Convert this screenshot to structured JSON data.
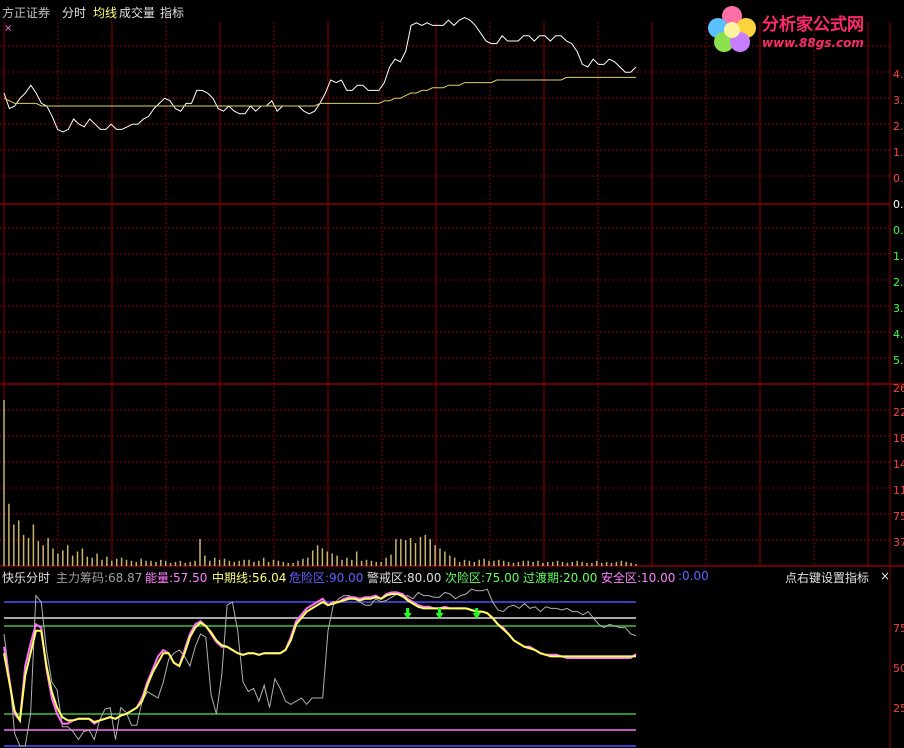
{
  "header": {
    "broker": "方正证券",
    "tabs": [
      "分时",
      "均线",
      "成交量",
      "指标"
    ],
    "tab_colors": [
      "#e0e0e0",
      "#ffff80",
      "#e0e0e0",
      "#e0e0e0"
    ]
  },
  "watermark": {
    "name": "分析家公式网",
    "url": "www.88gs.com"
  },
  "price_axis_labels": [
    "4.",
    "3.",
    "2.",
    "1.",
    "0.",
    "0.",
    "0.",
    "1.",
    "2.",
    "3.",
    "4.",
    "5."
  ],
  "volume_axis_labels": [
    "26",
    "22",
    "18",
    "14",
    "11",
    "75",
    "37"
  ],
  "indicator_axis_labels": [
    "75",
    "50",
    "25"
  ],
  "indicator_legend": {
    "name": "快乐分时",
    "items": [
      {
        "label": "主力筹码:",
        "value": "68.87",
        "color": "#a0a0a0"
      },
      {
        "label": "能量:",
        "value": "57.50",
        "color": "#ff80ff"
      },
      {
        "label": "中期线:",
        "value": "56.04",
        "color": "#ffff80"
      },
      {
        "label": "危险区:",
        "value": "90.00",
        "color": "#6060ff"
      },
      {
        "label": "警戒区:",
        "value": "80.00",
        "color": "#e0e0e0"
      },
      {
        "label": "次险区:",
        "value": "75.00",
        "color": "#60ff60"
      },
      {
        "label": "过渡期:",
        "value": "20.00",
        "color": "#60ff60"
      },
      {
        "label": "安全区:",
        "value": "10.00",
        "color": "#ff80ff"
      },
      {
        "label": ":",
        "value": "0.00",
        "color": "#6060ff"
      }
    ],
    "right_hint": "点右键设置指标"
  },
  "colors": {
    "grid": "#8b0000",
    "price_line": "#ffffff",
    "avg_line": "#e0d060",
    "volume_bar": "#c8b46e",
    "up_label": "#ff4040",
    "down_label": "#40ff40"
  },
  "chart_data": [
    {
      "type": "line",
      "name": "intraday-price",
      "series": [
        {
          "name": "price",
          "values": [
            3.0,
            2.4,
            2.5,
            2.8,
            3.0,
            3.3,
            3.0,
            2.6,
            2.5,
            2.1,
            1.6,
            1.5,
            1.6,
            2.0,
            1.8,
            1.7,
            2.0,
            1.8,
            1.6,
            1.6,
            1.8,
            1.6,
            1.6,
            1.7,
            1.8,
            1.8,
            2.0,
            2.1,
            2.4,
            2.6,
            2.8,
            2.7,
            2.4,
            2.3,
            2.6,
            2.6,
            3.1,
            3.1,
            3.0,
            2.8,
            2.4,
            2.3,
            2.5,
            2.3,
            2.2,
            2.2,
            2.5,
            2.3,
            2.5,
            2.5,
            2.7,
            2.3,
            2.5,
            2.5,
            2.5,
            2.5,
            2.3,
            2.2,
            2.3,
            2.6,
            3.0,
            3.5,
            3.4,
            3.5,
            3.1,
            3.1,
            3.3,
            3.3,
            3.1,
            3.1,
            3.1,
            3.4,
            4.0,
            4.3,
            4.2,
            4.6,
            5.6,
            5.7,
            5.6,
            5.7,
            5.6,
            5.6,
            5.6,
            5.8,
            5.6,
            5.8,
            5.9,
            5.8,
            5.6,
            5.3,
            5.0,
            4.9,
            4.9,
            5.2,
            5.0,
            5.0,
            5.0,
            5.2,
            5.2,
            5.0,
            5.2,
            5.2,
            5.0,
            5.2,
            5.2,
            5.0,
            4.9,
            4.6,
            4.1,
            4.0,
            4.3,
            4.1,
            4.1,
            4.3,
            4.2,
            4.0,
            3.8,
            3.8,
            4.0
          ]
        },
        {
          "name": "average",
          "values": [
            2.8,
            2.7,
            2.6,
            2.6,
            2.6,
            2.6,
            2.6,
            2.5,
            2.5,
            2.5,
            2.5,
            2.5,
            2.5,
            2.5,
            2.5,
            2.5,
            2.5,
            2.5,
            2.5,
            2.5,
            2.5,
            2.5,
            2.5,
            2.5,
            2.5,
            2.5,
            2.5,
            2.5,
            2.5,
            2.5,
            2.5,
            2.5,
            2.5,
            2.5,
            2.5,
            2.5,
            2.5,
            2.5,
            2.5,
            2.5,
            2.5,
            2.5,
            2.5,
            2.5,
            2.5,
            2.5,
            2.5,
            2.5,
            2.5,
            2.5,
            2.5,
            2.5,
            2.5,
            2.5,
            2.5,
            2.5,
            2.5,
            2.5,
            2.5,
            2.6,
            2.6,
            2.6,
            2.6,
            2.6,
            2.6,
            2.6,
            2.6,
            2.6,
            2.6,
            2.6,
            2.6,
            2.7,
            2.7,
            2.8,
            2.8,
            2.9,
            3.0,
            3.0,
            3.1,
            3.1,
            3.2,
            3.2,
            3.2,
            3.3,
            3.3,
            3.3,
            3.4,
            3.4,
            3.4,
            3.4,
            3.4,
            3.4,
            3.5,
            3.5,
            3.5,
            3.5,
            3.5,
            3.5,
            3.5,
            3.5,
            3.5,
            3.5,
            3.5,
            3.5,
            3.5,
            3.6,
            3.6,
            3.6,
            3.6,
            3.6,
            3.6,
            3.6,
            3.6,
            3.6,
            3.6,
            3.6,
            3.6,
            3.6,
            3.6
          ]
        }
      ]
    },
    {
      "type": "bar",
      "name": "volume",
      "values": [
        160,
        60,
        40,
        44,
        30,
        27,
        40,
        24,
        20,
        27,
        17,
        12,
        15,
        20,
        10,
        14,
        17,
        9,
        8,
        12,
        6,
        9,
        5,
        7,
        8,
        6,
        5,
        4,
        7,
        5,
        5,
        4,
        6,
        5,
        3,
        4,
        5,
        3,
        4,
        5,
        26,
        10,
        5,
        8,
        6,
        7,
        5,
        4,
        5,
        6,
        6,
        4,
        5,
        8,
        4,
        6,
        5,
        4,
        3,
        3,
        5,
        7,
        8,
        15,
        20,
        17,
        14,
        12,
        10,
        6,
        8,
        6,
        14,
        5,
        6,
        5,
        4,
        4,
        8,
        11,
        26,
        26,
        25,
        27,
        22,
        28,
        30,
        26,
        20,
        17,
        14,
        10,
        8,
        4,
        6,
        5,
        4,
        6,
        7,
        5,
        5,
        6,
        5,
        4,
        3,
        4,
        5,
        5,
        4,
        5,
        3,
        4,
        4,
        5,
        4,
        3,
        4,
        5,
        4,
        3,
        3,
        5,
        3,
        4,
        3,
        4,
        5,
        4,
        3,
        2
      ]
    },
    {
      "type": "line",
      "name": "快乐分时",
      "ylim": [
        0,
        100
      ],
      "series": [
        {
          "name": "主力筹码",
          "values": [
            70,
            44,
            8,
            0,
            0,
            20,
            94,
            90,
            60,
            40,
            35,
            12,
            12,
            9,
            4,
            9,
            10,
            4,
            16,
            23,
            24,
            4,
            24,
            21,
            13,
            13,
            28,
            34,
            32,
            30,
            40,
            54,
            58,
            60,
            56,
            50,
            62,
            70,
            68,
            32,
            20,
            44,
            88,
            90,
            72,
            40,
            34,
            36,
            28,
            38,
            24,
            42,
            36,
            28,
            26,
            28,
            30,
            26,
            30,
            30,
            30,
            72,
            88,
            92,
            94,
            94,
            92,
            90,
            88,
            88,
            92,
            90,
            91,
            93,
            95,
            93,
            94,
            92,
            96,
            94,
            94,
            93,
            93,
            96,
            95,
            92,
            94,
            95,
            98,
            97,
            97,
            98,
            90,
            85,
            84,
            87,
            88,
            86,
            89,
            86,
            87,
            84,
            87,
            86,
            86,
            85,
            86,
            84,
            84,
            82,
            84,
            80,
            76,
            74,
            76,
            75,
            74,
            74,
            70,
            69
          ]
        },
        {
          "name": "能量",
          "values": [
            62,
            42,
            20,
            16,
            50,
            64,
            76,
            74,
            48,
            30,
            20,
            14,
            14,
            16,
            17,
            17,
            17,
            14,
            16,
            17,
            18,
            17,
            19,
            20,
            22,
            24,
            30,
            40,
            48,
            56,
            60,
            58,
            52,
            50,
            60,
            70,
            76,
            78,
            75,
            70,
            65,
            62,
            62,
            60,
            58,
            57,
            58,
            58,
            57,
            58,
            58,
            58,
            58,
            60,
            68,
            78,
            82,
            86,
            88,
            90,
            92,
            88,
            90,
            90,
            92,
            93,
            93,
            92,
            93,
            93,
            94,
            92,
            95,
            96,
            96,
            95,
            92,
            90,
            88,
            87,
            87,
            86,
            86,
            87,
            86,
            86,
            86,
            86,
            85,
            84,
            84,
            83,
            80,
            76,
            74,
            70,
            66,
            64,
            62,
            62,
            60,
            58,
            57,
            57,
            57,
            56,
            55,
            55,
            55,
            55,
            55,
            55,
            55,
            55,
            55,
            55,
            55,
            55,
            55,
            57.5
          ]
        },
        {
          "name": "中期线",
          "values": [
            58,
            40,
            22,
            16,
            44,
            58,
            72,
            72,
            50,
            34,
            24,
            18,
            16,
            16,
            17,
            17,
            17,
            15,
            16,
            17,
            18,
            17,
            19,
            20,
            22,
            24,
            28,
            38,
            46,
            52,
            58,
            58,
            52,
            50,
            58,
            68,
            74,
            77,
            75,
            71,
            66,
            63,
            62,
            60,
            58,
            57,
            58,
            58,
            57,
            58,
            58,
            58,
            58,
            60,
            66,
            76,
            80,
            84,
            86,
            88,
            90,
            88,
            89,
            90,
            91,
            92,
            92,
            91,
            92,
            92,
            93,
            92,
            94,
            95,
            95,
            94,
            91,
            89,
            87,
            86,
            86,
            86,
            86,
            86,
            86,
            86,
            86,
            86,
            85,
            84,
            84,
            83,
            80,
            76,
            73,
            70,
            66,
            64,
            62,
            61,
            60,
            58,
            57,
            56,
            56,
            56,
            56,
            56,
            56,
            56,
            56,
            56,
            56,
            56,
            56,
            56,
            56,
            56,
            56,
            56.04
          ]
        }
      ],
      "reference_lines": [
        {
          "name": "危险区",
          "value": 90
        },
        {
          "name": "警戒区",
          "value": 80
        },
        {
          "name": "次险区",
          "value": 75
        },
        {
          "name": "过渡期",
          "value": 20
        },
        {
          "name": "安全区",
          "value": 10
        },
        {
          "name": "zero",
          "value": 0
        }
      ],
      "signal_arrows": [
        76,
        82,
        89
      ]
    }
  ]
}
